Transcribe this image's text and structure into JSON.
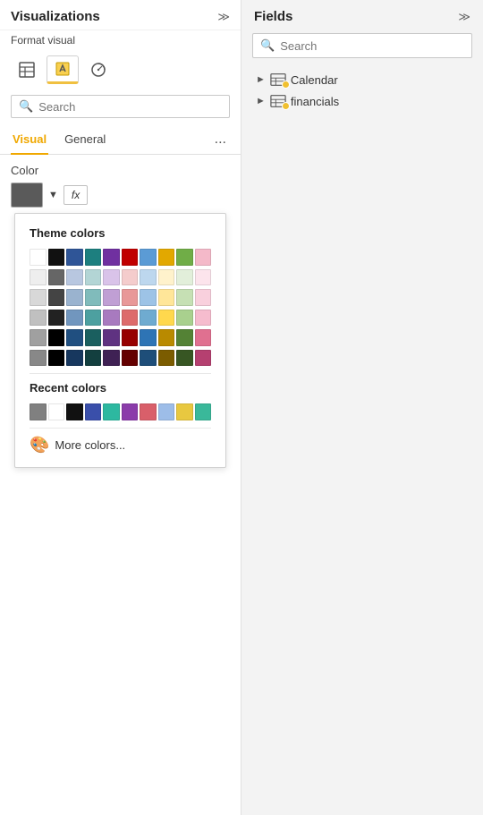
{
  "left_panel": {
    "title": "Visualizations",
    "format_visual_label": "Format visual",
    "search_placeholder": "Search",
    "tabs": [
      {
        "label": "Visual",
        "active": true
      },
      {
        "label": "General",
        "active": false
      }
    ],
    "tab_more": "...",
    "expand_icon": "≫",
    "color_section": {
      "label": "Color",
      "swatch_color": "#5a5a5a",
      "fx_label": "fx"
    },
    "theme_colors": {
      "heading": "Theme colors",
      "row1": [
        "#ffffff",
        "#111111",
        "#2f5597",
        "#1d7f7f",
        "#7030a0",
        "#c00000",
        "#5b9bd5",
        "#e2a800",
        "#70ad47",
        "#f4b9c9"
      ],
      "row2": [
        "#eeeeee",
        "#666666",
        "#b8c7e0",
        "#b3d5d5",
        "#d9c3e9",
        "#f4cccc",
        "#bdd7ee",
        "#fff2cc",
        "#e2efda",
        "#fce4ec"
      ],
      "row3": [
        "#d8d8d8",
        "#444444",
        "#9ab3cf",
        "#80bbbb",
        "#c09fd4",
        "#e89898",
        "#9dc3e6",
        "#ffe699",
        "#c6e0b4",
        "#f9d0dd"
      ],
      "row4": [
        "#c0c0c0",
        "#222222",
        "#7196be",
        "#4da0a0",
        "#a87abf",
        "#dd6b6b",
        "#6fabd0",
        "#ffd84d",
        "#a9d08e",
        "#f6bcce"
      ],
      "row5": [
        "#a0a0a0",
        "#000000",
        "#204f80",
        "#1a5f5f",
        "#5f3281",
        "#960000",
        "#2e74b5",
        "#b98a00",
        "#548235",
        "#e07090"
      ],
      "row6": [
        "#888888",
        "#000000",
        "#17375e",
        "#133f3f",
        "#3f2154",
        "#640000",
        "#1e4e79",
        "#7b5c00",
        "#375623",
        "#b54070"
      ]
    },
    "recent_colors": {
      "heading": "Recent colors",
      "colors": [
        "#808080",
        "#ffffff",
        "#111111",
        "#3a4faa",
        "#2db8a0",
        "#8b3caa",
        "#d95f6a",
        "#9dbde8",
        "#e8c840",
        "#3ab89a"
      ]
    },
    "more_colors_label": "More colors..."
  },
  "right_panel": {
    "title": "Fields",
    "expand_icon": "≫",
    "search_placeholder": "Search",
    "fields": [
      {
        "name": "Calendar",
        "has_badge": true
      },
      {
        "name": "financials",
        "has_badge": true
      }
    ]
  }
}
